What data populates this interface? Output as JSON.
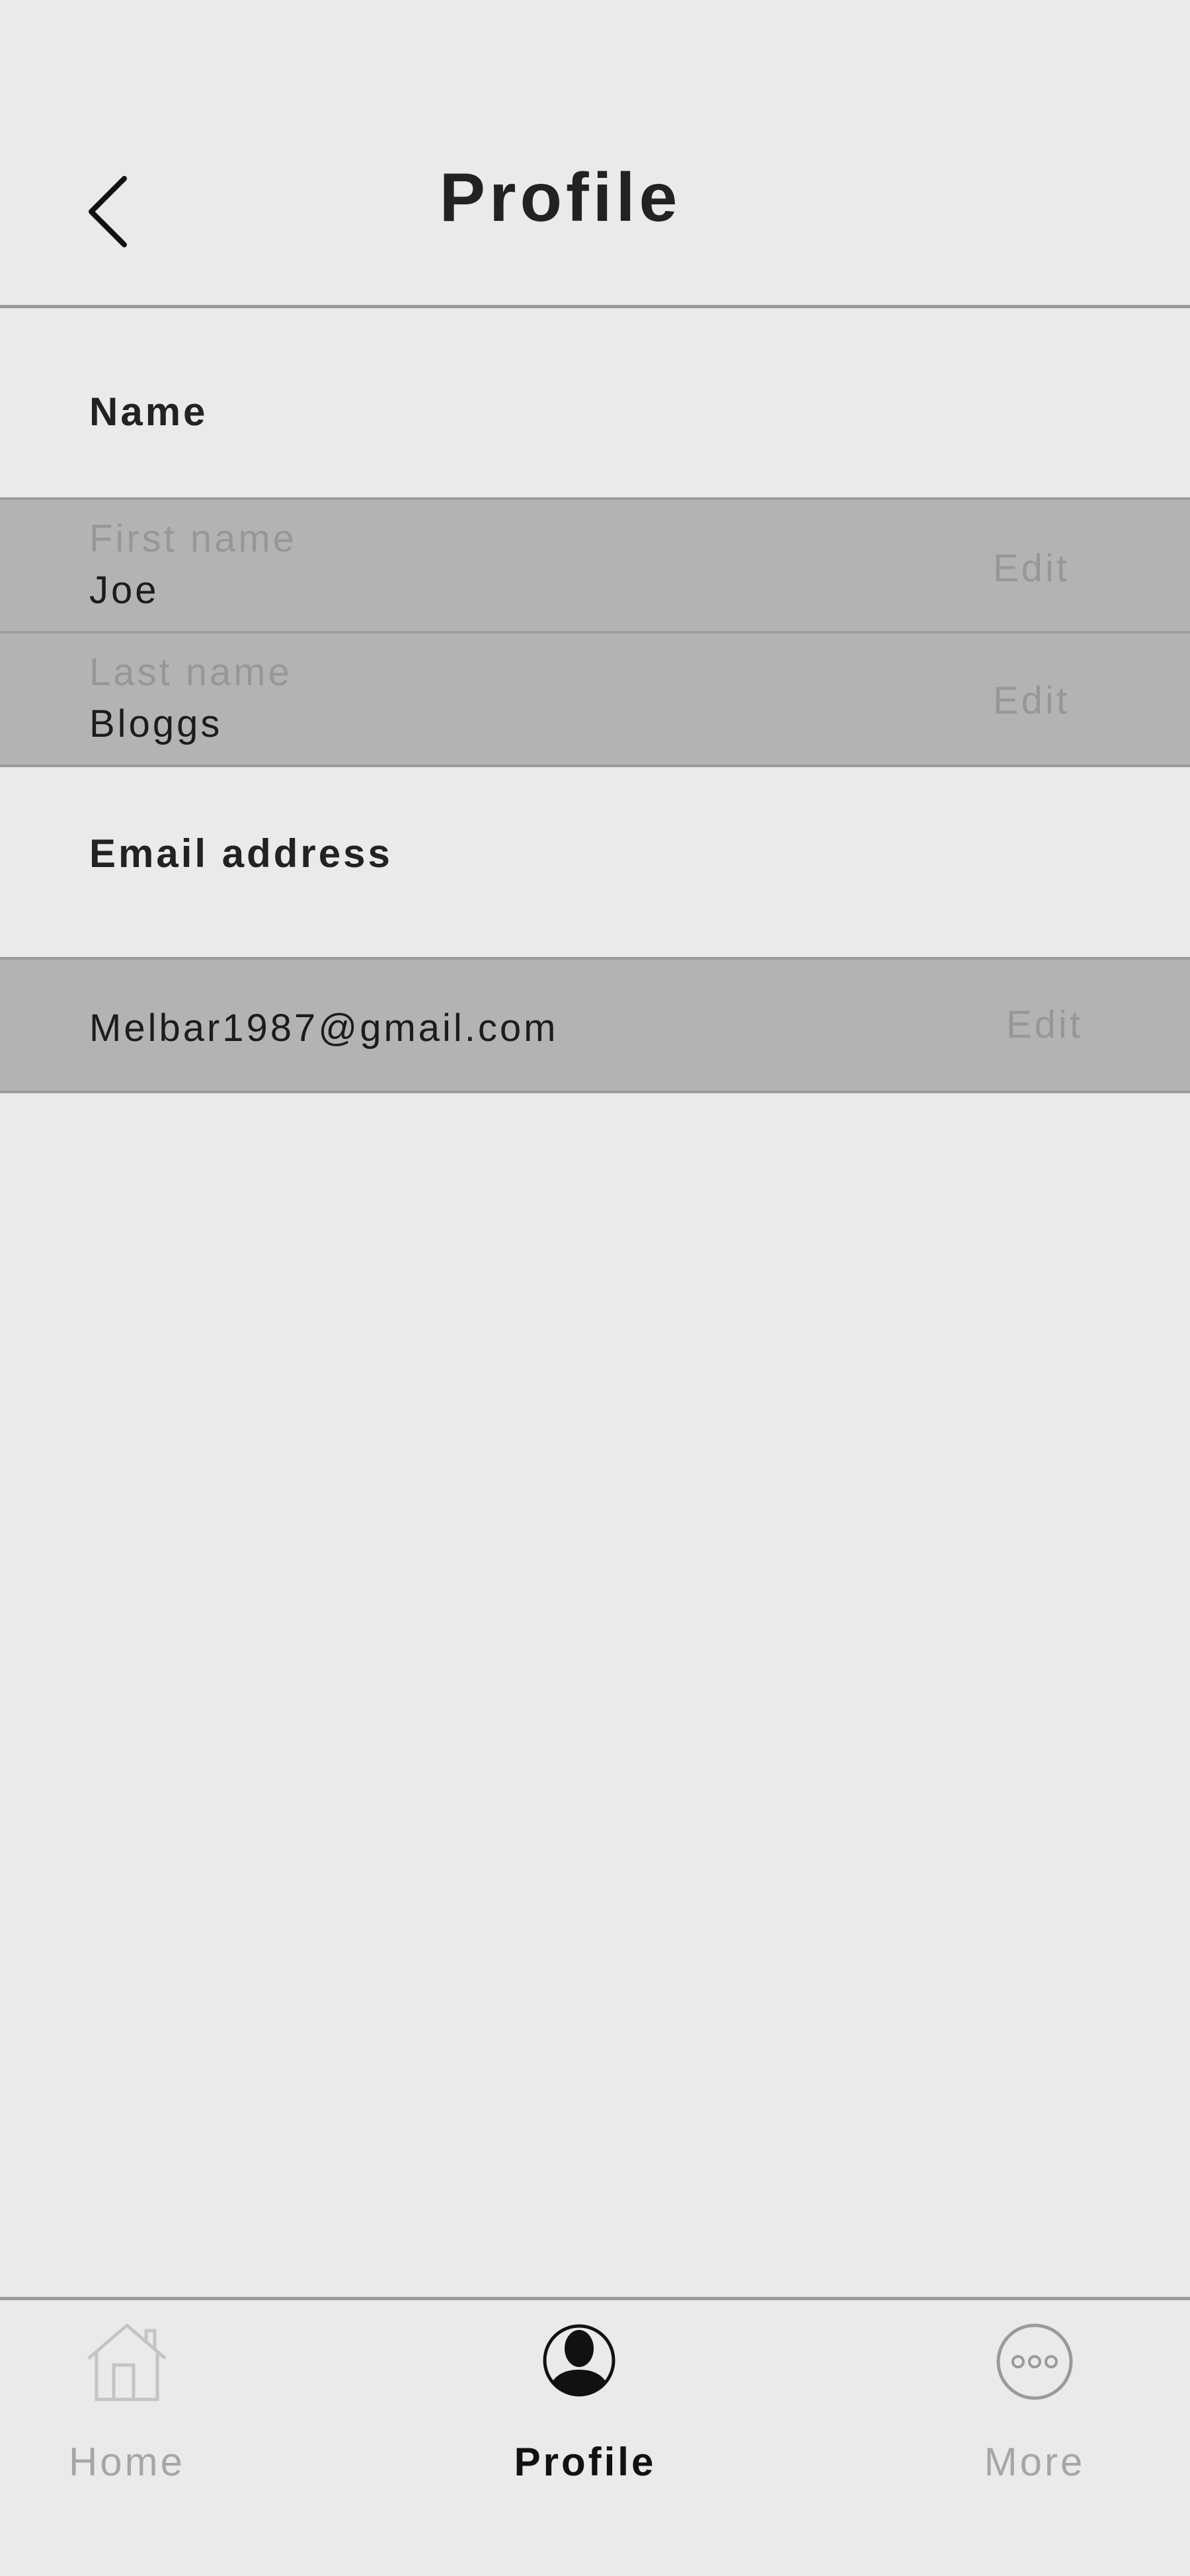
{
  "header": {
    "title": "Profile",
    "back_icon": "chevron-left-icon"
  },
  "name_section": {
    "heading": "Name",
    "fields": [
      {
        "label": "First name",
        "value": "Joe",
        "action": "Edit"
      },
      {
        "label": "Last name",
        "value": "Bloggs",
        "action": "Edit"
      }
    ]
  },
  "email_section": {
    "heading": "Email address",
    "value": "Melbar1987@gmail.com",
    "action": "Edit"
  },
  "tabbar": {
    "tabs": [
      {
        "label": "Home",
        "icon": "home-icon",
        "active": false
      },
      {
        "label": "Profile",
        "icon": "user-icon",
        "active": true
      },
      {
        "label": "More",
        "icon": "more-icon",
        "active": false
      }
    ]
  },
  "colors": {
    "background": "#eaeaea",
    "row_background": "#b3b3b3",
    "divider": "#9c9c9c",
    "muted_text": "#979797",
    "primary_text": "#1c1c1c"
  }
}
